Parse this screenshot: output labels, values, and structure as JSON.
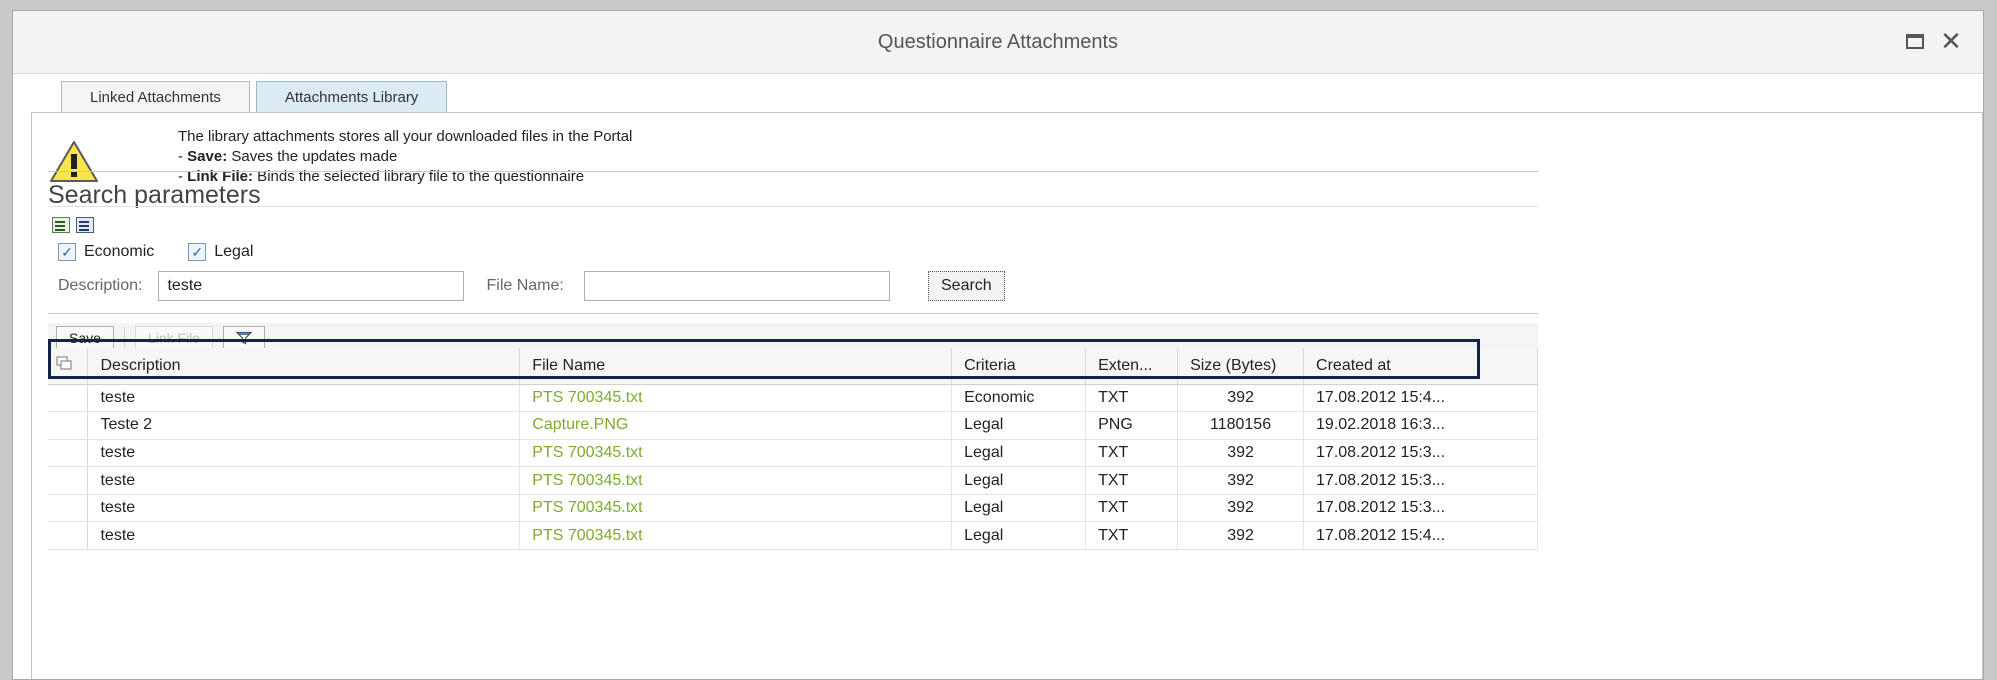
{
  "window": {
    "title": "Questionnaire Attachments"
  },
  "tabs": [
    {
      "label": "Linked Attachments",
      "active": false
    },
    {
      "label": "Attachments Library",
      "active": true
    }
  ],
  "info": {
    "line1": "The library attachments stores all your downloaded files in the Portal",
    "save_label": "Save:",
    "save_desc": " Saves the updates made",
    "link_label": "Link File:",
    "link_desc": " Binds the selected library file to the questionnaire",
    "bullet": "- "
  },
  "search": {
    "title": "Search parameters",
    "checks": [
      {
        "label": "Economic",
        "checked": true
      },
      {
        "label": "Legal",
        "checked": true
      }
    ],
    "description_label": "Description:",
    "description_value": "teste",
    "filename_label": "File Name:",
    "filename_value": "",
    "button": "Search"
  },
  "toolbar": {
    "save": "Save",
    "link_file": "Link File"
  },
  "table": {
    "columns": [
      "Description",
      "File Name",
      "Criteria",
      "Exten...",
      "Size (Bytes)",
      "Created at"
    ],
    "rows": [
      [
        "teste",
        "PTS 700345.txt",
        "Economic",
        "TXT",
        "392",
        "17.08.2012 15:4..."
      ],
      [
        "Teste 2",
        "Capture.PNG",
        "Legal",
        "PNG",
        "1180156",
        "19.02.2018 16:3..."
      ],
      [
        "teste",
        "PTS 700345.txt",
        "Legal",
        "TXT",
        "392",
        "17.08.2012 15:3..."
      ],
      [
        "teste",
        "PTS 700345.txt",
        "Legal",
        "TXT",
        "392",
        "17.08.2012 15:3..."
      ],
      [
        "teste",
        "PTS 700345.txt",
        "Legal",
        "TXT",
        "392",
        "17.08.2012 15:3..."
      ],
      [
        "teste",
        "PTS 700345.txt",
        "Legal",
        "TXT",
        "392",
        "17.08.2012 15:4..."
      ]
    ]
  },
  "colors": {
    "link": "#7cab2e",
    "highlight_border": "#14234a",
    "active_tab": "#dceaf4"
  }
}
